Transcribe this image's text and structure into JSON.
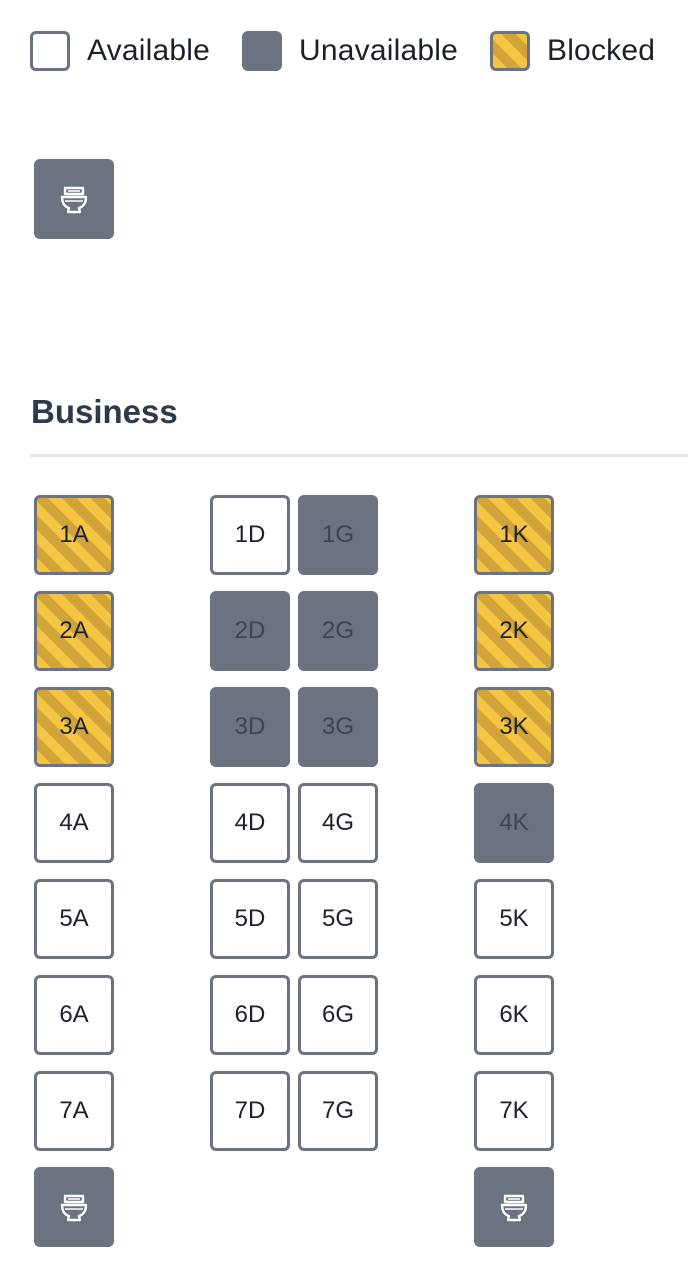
{
  "legend": {
    "available_label": "Available",
    "unavailable_label": "Unavailable",
    "blocked_label": "Blocked"
  },
  "lavatory_icon": "toilet-icon",
  "section": {
    "title": "Business"
  },
  "seats": {
    "1A": "1A",
    "1D": "1D",
    "1G": "1G",
    "1K": "1K",
    "2A": "2A",
    "2D": "2D",
    "2G": "2G",
    "2K": "2K",
    "3A": "3A",
    "3D": "3D",
    "3G": "3G",
    "3K": "3K",
    "4A": "4A",
    "4D": "4D",
    "4G": "4G",
    "4K": "4K",
    "5A": "5A",
    "5D": "5D",
    "5G": "5G",
    "5K": "5K",
    "6A": "6A",
    "6D": "6D",
    "6G": "6G",
    "6K": "6K",
    "7A": "7A",
    "7D": "7D",
    "7G": "7G",
    "7K": "7K"
  },
  "seat_status": {
    "1A": "blocked",
    "1D": "available",
    "1G": "unavailable",
    "1K": "blocked",
    "2A": "blocked",
    "2D": "unavailable",
    "2G": "unavailable",
    "2K": "blocked",
    "3A": "blocked",
    "3D": "unavailable",
    "3G": "unavailable",
    "3K": "blocked",
    "4A": "available",
    "4D": "available",
    "4G": "available",
    "4K": "unavailable",
    "5A": "available",
    "5D": "available",
    "5G": "available",
    "5K": "available",
    "6A": "available",
    "6D": "available",
    "6G": "available",
    "6K": "available",
    "7A": "available",
    "7D": "available",
    "7G": "available",
    "7K": "available"
  },
  "colors": {
    "unavailable": "#6b7280",
    "blocked_primary": "#f4c443",
    "blocked_stripe": "#d1a43a",
    "available_border": "#6b7280"
  }
}
